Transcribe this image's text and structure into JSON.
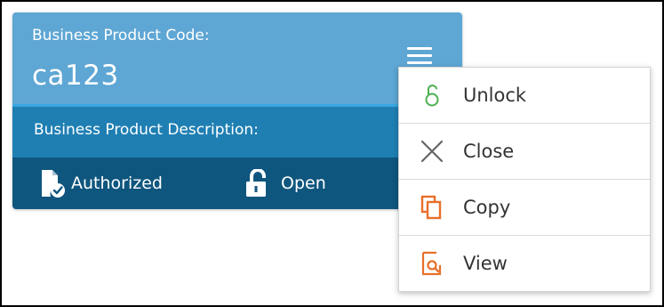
{
  "card": {
    "code_label": "Business Product Code:",
    "code_value": "ca123",
    "description_label": "Business Product Description:",
    "status_authorization": "Authorized",
    "status_lock": "Open"
  },
  "menu": {
    "items": [
      {
        "label": "Unlock",
        "icon": "unlock-icon"
      },
      {
        "label": "Close",
        "icon": "close-icon"
      },
      {
        "label": "Copy",
        "icon": "copy-icon"
      },
      {
        "label": "View",
        "icon": "view-icon"
      }
    ]
  },
  "colors": {
    "header_bg": "#5ea6d4",
    "description_bg": "#1f7fb3",
    "footer_bg": "#0f567e",
    "unlock_icon": "#4caf50",
    "close_icon": "#666666",
    "copy_icon": "#e8702a",
    "view_icon": "#e8702a"
  }
}
